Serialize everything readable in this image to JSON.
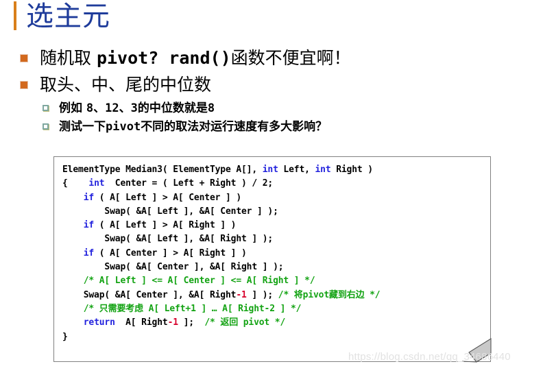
{
  "slide": {
    "title": "选主元",
    "accent_color": "#D97F1A",
    "title_color": "#1F3C9B"
  },
  "bullets": [
    {
      "level": 1,
      "marker": "filled-square-bullet",
      "segments": [
        {
          "text": "随机取 ",
          "mono": false
        },
        {
          "text": "pivot? rand()",
          "mono": true
        },
        {
          "text": "函数不便宜啊！",
          "mono": false
        }
      ],
      "plain": "随机取 pivot? rand()函数不便宜啊！"
    },
    {
      "level": 1,
      "marker": "filled-square-bullet",
      "segments": [
        {
          "text": "取头、中、尾的中位数",
          "mono": false
        }
      ],
      "plain": "取头、中、尾的中位数"
    },
    {
      "level": 2,
      "marker": "hollow-square-bullet",
      "segments": [
        {
          "text": "例如 ",
          "mono": false
        },
        {
          "text": "8",
          "mono": true
        },
        {
          "text": "、",
          "mono": false
        },
        {
          "text": "12",
          "mono": true
        },
        {
          "text": "、",
          "mono": false
        },
        {
          "text": "3",
          "mono": true
        },
        {
          "text": "的中位数就是",
          "mono": false
        },
        {
          "text": "8",
          "mono": true
        }
      ],
      "plain": "例如 8、12、3的中位数就是8"
    },
    {
      "level": 2,
      "marker": "hollow-square-bullet",
      "segments": [
        {
          "text": "测试一下",
          "mono": false
        },
        {
          "text": "pivot",
          "mono": true
        },
        {
          "text": "不同的取法对运行速度有多大影响？",
          "mono": false
        }
      ],
      "plain": "测试一下pivot不同的取法对运行速度有多大影响？"
    }
  ],
  "code_block": {
    "language": "c",
    "colors": {
      "keyword": "#2222DD",
      "comment": "#13A313",
      "number": "#D7002B",
      "plain": "#000000",
      "border": "#808080",
      "background": "#ffffff"
    },
    "lines": [
      [
        {
          "t": "ElementType Median3( ElementType A[], ",
          "c": "pl"
        },
        {
          "t": "int",
          "c": "kw"
        },
        {
          "t": " Left, ",
          "c": "pl"
        },
        {
          "t": "int",
          "c": "kw"
        },
        {
          "t": " Right )",
          "c": "pl"
        }
      ],
      [
        {
          "t": "{    ",
          "c": "pl"
        },
        {
          "t": "int",
          "c": "kw"
        },
        {
          "t": "  Center = ( Left + Right ) / 2;",
          "c": "pl"
        }
      ],
      [
        {
          "t": "    ",
          "c": "pl"
        },
        {
          "t": "if",
          "c": "kw"
        },
        {
          "t": " ( A[ Left ] > A[ Center ] )",
          "c": "pl"
        }
      ],
      [
        {
          "t": "        Swap( &A[ Left ], &A[ Center ] );",
          "c": "pl"
        }
      ],
      [
        {
          "t": "    ",
          "c": "pl"
        },
        {
          "t": "if",
          "c": "kw"
        },
        {
          "t": " ( A[ Left ] > A[ Right ] )",
          "c": "pl"
        }
      ],
      [
        {
          "t": "        Swap( &A[ Left ], &A[ Right ] );",
          "c": "pl"
        }
      ],
      [
        {
          "t": "    ",
          "c": "pl"
        },
        {
          "t": "if",
          "c": "kw"
        },
        {
          "t": " ( A[ Center ] > A[ Right ] )",
          "c": "pl"
        }
      ],
      [
        {
          "t": "        Swap( &A[ Center ], &A[ Right ] );",
          "c": "pl"
        }
      ],
      [
        {
          "t": "    ",
          "c": "pl"
        },
        {
          "t": "/* A[ Left ] <= A[ Center ] <= A[ Right ] */",
          "c": "cm"
        }
      ],
      [
        {
          "t": "    Swap( &A[ Center ], &A[ Right",
          "c": "pl"
        },
        {
          "t": "-1",
          "c": "num"
        },
        {
          "t": " ] ); ",
          "c": "pl"
        },
        {
          "t": "/* 将pivot藏到右边 */",
          "c": "cm"
        }
      ],
      [
        {
          "t": "    ",
          "c": "pl"
        },
        {
          "t": "/* 只需要考虑 A[ Left+1 ] … A[ Right-2 ] */",
          "c": "cm"
        }
      ],
      [
        {
          "t": "    ",
          "c": "pl"
        },
        {
          "t": "return",
          "c": "kw"
        },
        {
          "t": "  A[ Right",
          "c": "pl"
        },
        {
          "t": "-1",
          "c": "num"
        },
        {
          "t": " ];  ",
          "c": "pl"
        },
        {
          "t": "/* 返回 pivot */",
          "c": "cm"
        }
      ],
      [
        {
          "t": "}",
          "c": "pl"
        }
      ]
    ]
  },
  "watermark": {
    "text": "https://blog.csdn.net/qq_34686440"
  }
}
